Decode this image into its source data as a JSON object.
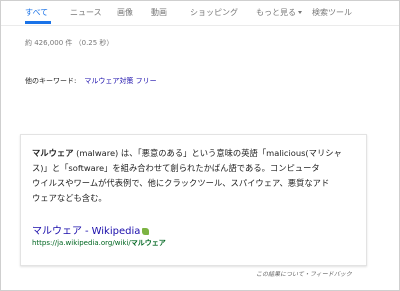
{
  "colors": {
    "accent": "#1a73e8",
    "link": "#1a0dab",
    "url_green": "#006621",
    "muted_text": "#777777",
    "body_text": "#222222",
    "wiki_badge": "#7cb342"
  },
  "tabs": [
    {
      "label": "すべて",
      "active": true
    },
    {
      "label": "ニュース"
    },
    {
      "label": "画像"
    },
    {
      "label": "動画"
    },
    {
      "label": "ショッピング"
    },
    {
      "label": "もっと見る",
      "icon": "caret-down-icon"
    },
    {
      "label": "検索ツール"
    }
  ],
  "result_stats": "約 426,000 件 （0.25 秒）",
  "other_keywords": {
    "label": "他のキーワード:",
    "links": [
      "マルウェア対策 フリー"
    ]
  },
  "knowledge_card": {
    "term": "マルウェア",
    "line1_rest": " (malware) は、「悪意のある」という意味の英語「malicious(マリシャ",
    "line2": "ス)」と「software」を組み合わせて創られたかばん語である。コンピュータ",
    "line3": "ウイルスやワームが代表例で、他にクラックツール、スパイウェア、悪質なアド",
    "line4": "ウェアなども含む。",
    "source_name": "マルウェア",
    "source_sep": "-",
    "source_site": "Wikipedia",
    "source_icon": "wikipedia-leaf-icon",
    "url_prefix": "https://ja.wikipedia.org/wiki/",
    "url_term": "マルウェア"
  },
  "feedback": "この結果について・フィードバック"
}
